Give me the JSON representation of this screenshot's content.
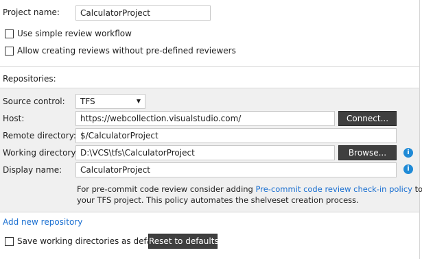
{
  "project": {
    "name_label": "Project name:",
    "name_value": "CalculatorProject",
    "simple_review_label": "Use simple review workflow",
    "allow_reviews_label": "Allow creating reviews without pre-defined reviewers"
  },
  "repositories": {
    "heading": "Repositories:",
    "source_control_label": "Source control:",
    "source_control_value": "TFS",
    "host_label": "Host:",
    "host_value": "https://webcollection.visualstudio.com/",
    "connect_label": "Connect...",
    "remote_dir_label": "Remote directory:",
    "remote_dir_value": "$/CalculatorProject",
    "working_dir_label": "Working directory:",
    "working_dir_value": "D:\\VCS\\tfs\\CalculatorProject",
    "browse_label": "Browse...",
    "display_name_label": "Display name:",
    "display_name_value": "CalculatorProject",
    "info_glyph": "i",
    "note_before_link": "For pre-commit code review consider adding ",
    "note_link": "Pre-commit code review check-in policy",
    "note_after_link": " to",
    "note_line2": "your TFS project. This policy automates the shelveset creation process."
  },
  "footer": {
    "add_repo_link": "Add new repository",
    "save_default_label": "Save working directories as default",
    "reset_label": "Reset to defaults"
  },
  "colors": {
    "panel_bg": "#f0f0f0",
    "button_bg": "#3f3f3f",
    "link": "#1a6fd1",
    "info_icon": "#1f8ad6"
  }
}
